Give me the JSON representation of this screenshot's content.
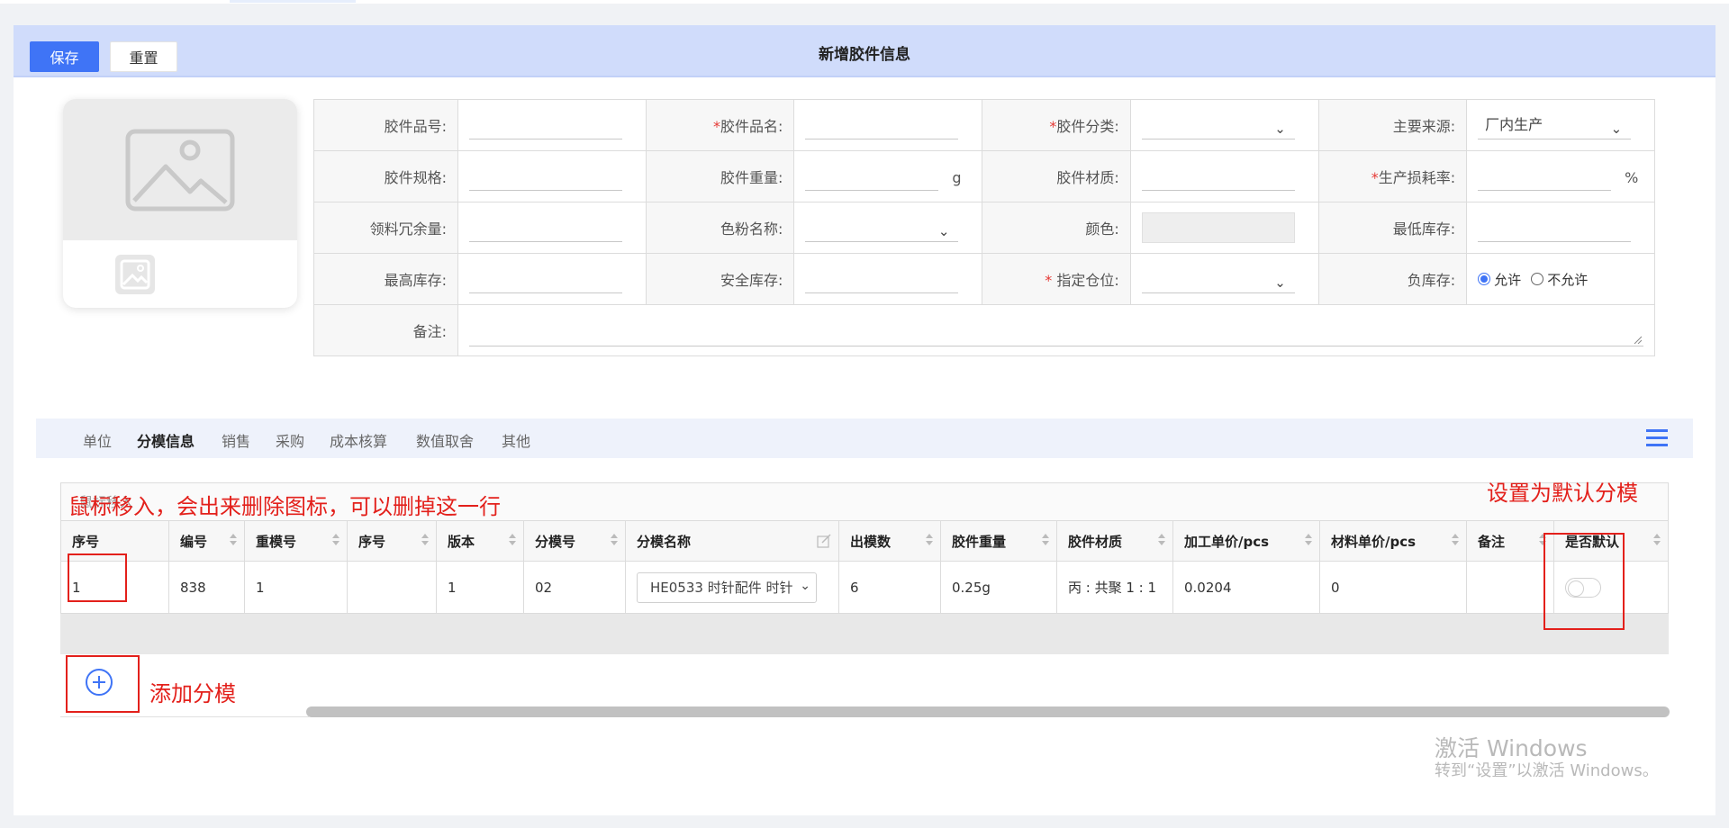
{
  "header": {
    "save_label": "保存",
    "reset_label": "重置",
    "title": "新增胶件信息"
  },
  "form": {
    "part_no_label": "胶件品号:",
    "part_name_label": "胶件品名:",
    "category_label": "胶件分类:",
    "source_label": "主要来源:",
    "source_value": "厂内生产",
    "spec_label": "胶件规格:",
    "weight_label": "胶件重量:",
    "weight_unit": "g",
    "material_label": "胶件材质:",
    "loss_rate_label": "生产损耗率:",
    "loss_rate_unit": "%",
    "surplus_label": "领料冗余量:",
    "toner_label": "色粉名称:",
    "color_label": "颜色:",
    "min_stock_label": "最低库存:",
    "max_stock_label": "最高库存:",
    "safe_stock_label": "安全库存:",
    "location_label": "指定仓位:",
    "negative_stock_label": "负库存:",
    "allow_label": "允许",
    "disallow_label": "不允许",
    "remark_label": "备注:",
    "required_mark": "*"
  },
  "tabs": [
    "单位",
    "分模信息",
    "销售",
    "采购",
    "成本核算",
    "数值取舍",
    "其他"
  ],
  "grid": {
    "ghost_text": "鼠标移入",
    "columns": [
      "序号",
      "编号",
      "重模号",
      "序号",
      "版本",
      "分模号",
      "分模名称",
      "出模数",
      "胶件重量",
      "胶件材质",
      "加工单价/pcs",
      "材料单价/pcs",
      "备注",
      "是否默认"
    ],
    "row": {
      "seq": "1",
      "code": "838",
      "heavy_mold": "1",
      "seq2": "",
      "version": "1",
      "sub_mold_no": "02",
      "sub_mold_name": "HE0533 时针配件  时针",
      "cavity_count": "6",
      "weight": "0.25g",
      "material": "丙 : 共聚 1 : 1",
      "process_price": "0.0204",
      "material_price": "0",
      "remark": ""
    }
  },
  "annotations": {
    "hover_note": "鼠标移入，会出来删除图标，可以删掉这一行",
    "default_note": "设置为默认分模",
    "add_note": "添加分模"
  },
  "watermark": {
    "line1": "激活 Windows",
    "line2": "转到“设置”以激活 Windows。"
  },
  "icons": [
    "image-placeholder-icon",
    "image-upload-icon",
    "chevron-down-icon",
    "menu-icon",
    "sort-icon",
    "edit-icon",
    "add-circle-icon",
    "toggle-switch"
  ],
  "colors": {
    "primary": "#3f74f6",
    "header_bg": "#d0dcfb",
    "annotation": "#e3201b",
    "required": "#e53935"
  }
}
